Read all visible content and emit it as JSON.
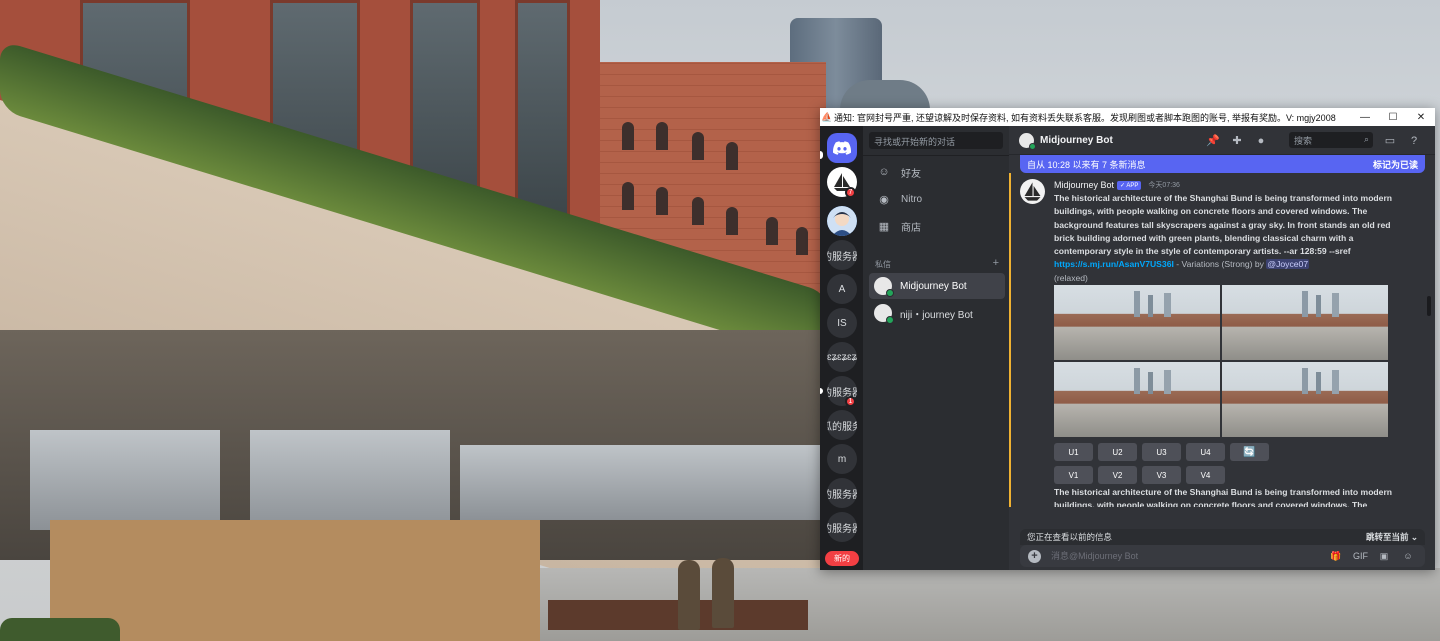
{
  "window": {
    "title": "通知: 官网封号严重, 还望谅解及时保存资料, 如有资料丢失联系客服。发现刷图或者脚本跑图的账号, 举报有奖励。V: mgjy2008",
    "minimize": "—",
    "maximize": "☐",
    "close": "✕"
  },
  "rail": {
    "home_icon": "discord-logo-icon",
    "servers": [
      {
        "label": "",
        "badge": "7"
      },
      {
        "label": "",
        "badge": ""
      },
      {
        "label": "的服务器",
        "badge": ""
      },
      {
        "label": "A",
        "badge": ""
      },
      {
        "label": "IS",
        "badge": ""
      },
      {
        "label": "ɛʑɛʑɛʑ",
        "badge": ""
      },
      {
        "label": "的服务器",
        "badge": "1"
      },
      {
        "label": "瓜的服务",
        "badge": ""
      },
      {
        "label": "m",
        "badge": ""
      },
      {
        "label": "的服务器",
        "badge": ""
      },
      {
        "label": "的服务器",
        "badge": ""
      }
    ],
    "new_label": "新的"
  },
  "dm": {
    "search_placeholder": "寻找或开始新的对话",
    "nav": [
      {
        "label": "好友",
        "icon": "friends-icon"
      },
      {
        "label": "Nitro",
        "icon": "nitro-icon"
      },
      {
        "label": "商店",
        "icon": "shop-icon"
      }
    ],
    "section_title": "私信",
    "add": "+",
    "list": [
      {
        "label": "Midjourney Bot",
        "active": true
      },
      {
        "label": "niji・journey Bot",
        "active": false
      }
    ]
  },
  "header": {
    "title": "Midjourney Bot",
    "search_placeholder": "搜索"
  },
  "new_messages": {
    "text": "自从 10:28 以来有 7 条新消息",
    "mark_read": "标记为已读"
  },
  "message": {
    "author": "Midjourney Bot",
    "app_tag": "APP",
    "time": "今天07:36",
    "prompt": "The historical architecture of the Shanghai Bund is being transformed into modern buildings, with people walking on concrete floors and covered windows. The background features tall skyscrapers against a gray sky. In front stands an old red brick building adorned with green plants, blending classical charm with a contemporary style in the style of contemporary artists. --ar 128:59 --sref ",
    "link": "https://s.mj.run/AsanV7US36I",
    "mid": " - Variations (Strong) by ",
    "mention": "@Joyce07",
    "mode": "(relaxed)",
    "upscale": [
      "U1",
      "U2",
      "U3",
      "U4"
    ],
    "reroll_icon": "reroll-icon",
    "variation": [
      "V1",
      "V2",
      "V3",
      "V4"
    ]
  },
  "message2": {
    "text": "The historical architecture of the Shanghai Bund is being transformed into modern buildings, with people walking on concrete floors and covered windows. The background features tall skyscrapers against a gray sky."
  },
  "older_bar": {
    "text": "您正在查看以前的信息",
    "jump": "跳转至当前"
  },
  "composer": {
    "placeholder": "消息@Midjourney Bot"
  },
  "colors": {
    "blurple": "#5865f2",
    "background": "#313338",
    "link": "#00a8fc",
    "online": "#23a55a",
    "highlight": "#f0b232"
  }
}
